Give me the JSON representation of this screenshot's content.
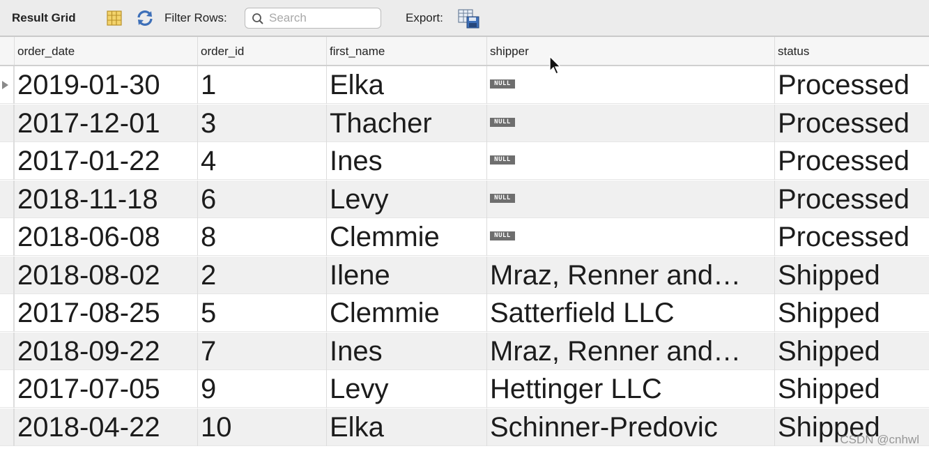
{
  "toolbar": {
    "title": "Result Grid",
    "filter_label": "Filter Rows:",
    "search_placeholder": "Search",
    "export_label": "Export:",
    "icons": [
      "grid-columns-icon",
      "refresh-icon",
      "search-icon",
      "export-icon"
    ]
  },
  "grid": {
    "columns": [
      "order_date",
      "order_id",
      "first_name",
      "shipper",
      "status"
    ],
    "null_label": "NULL",
    "rows": [
      {
        "order_date": "2019-01-30",
        "order_id": "1",
        "first_name": "Elka",
        "shipper": null,
        "status": "Processed"
      },
      {
        "order_date": "2017-12-01",
        "order_id": "3",
        "first_name": "Thacher",
        "shipper": null,
        "status": "Processed"
      },
      {
        "order_date": "2017-01-22",
        "order_id": "4",
        "first_name": "Ines",
        "shipper": null,
        "status": "Processed"
      },
      {
        "order_date": "2018-11-18",
        "order_id": "6",
        "first_name": "Levy",
        "shipper": null,
        "status": "Processed"
      },
      {
        "order_date": "2018-06-08",
        "order_id": "8",
        "first_name": "Clemmie",
        "shipper": null,
        "status": "Processed"
      },
      {
        "order_date": "2018-08-02",
        "order_id": "2",
        "first_name": "Ilene",
        "shipper": "Mraz, Renner and…",
        "status": "Shipped"
      },
      {
        "order_date": "2017-08-25",
        "order_id": "5",
        "first_name": "Clemmie",
        "shipper": "Satterfield LLC",
        "status": "Shipped"
      },
      {
        "order_date": "2018-09-22",
        "order_id": "7",
        "first_name": "Ines",
        "shipper": "Mraz, Renner and…",
        "status": "Shipped"
      },
      {
        "order_date": "2017-07-05",
        "order_id": "9",
        "first_name": "Levy",
        "shipper": "Hettinger LLC",
        "status": "Shipped"
      },
      {
        "order_date": "2018-04-22",
        "order_id": "10",
        "first_name": "Elka",
        "shipper": "Schinner-Predovic",
        "status": "Shipped"
      }
    ]
  },
  "watermark": "CSDN @cnhwl"
}
